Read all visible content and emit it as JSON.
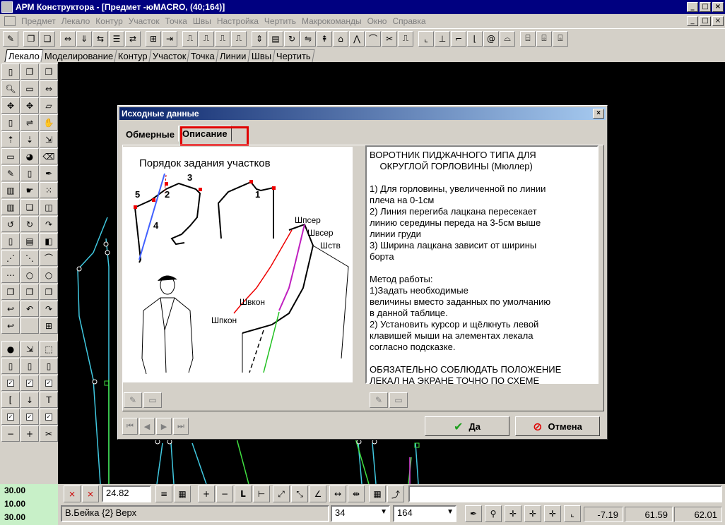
{
  "window": {
    "title": "АРМ Конструктора - [Предмет -юMACRO, (40;164)]",
    "min": "_",
    "max": "□",
    "close": "×"
  },
  "menu": [
    "Предмет",
    "Лекало",
    "Контур",
    "Участок",
    "Точка",
    "Швы",
    "Настройка",
    "Чертить",
    "Макрокоманды",
    "Окно",
    "Справка"
  ],
  "tabs": [
    "Лекало",
    "Моделирование",
    "Контур",
    "Участок",
    "Точка",
    "Линии",
    "Швы",
    "Чертить"
  ],
  "dialog": {
    "title": "Исходные данные",
    "close": "×",
    "tab1": "Обмерные",
    "tab2": "Описание",
    "image": {
      "heading": "Порядок задания участков",
      "n1": "1",
      "n2": "2",
      "n3": "3",
      "n4": "4",
      "n5": "5",
      "l1": "Шпсер",
      "l2": "Швсер",
      "l3": "Шств",
      "l4": "Швкон",
      "l5": "Шпкон"
    },
    "description": "ВОРОТНИК ПИДЖАЧНОГО ТИПА ДЛЯ\n    ОКРУГЛОЙ ГОРЛОВИНЫ (Мюллер)\n\n1) Для горловины, увеличенной по линии\nплеча на 0-1см\n2) Линия перегиба лацкана пересекает\nлинию середины переда на 3-5см выше\nлинии груди\n3) Ширина лацкана зависит от ширины\nборта\n\nМетод работы:\n1)Задать необходимые\nвеличины вместо заданных по умолчанию\nв данной таблице.\n2) Установить курсор и щёлкнуть левой\nклавишей мыши на элементах лекала\nсогласно подсказке.\n\nОБЯЗАТЕЛЬНО СОБЛЮДАТЬ ПОЛОЖЕНИЕ\nЛЕКАЛ НА ЭКРАНЕ ТОЧНО ПО СХЕМЕ",
    "ok": "Да",
    "cancel": "Отмена"
  },
  "bottom": {
    "num1": "30.00",
    "num2": "10.00",
    "num3": "30.00",
    "value": "24.82",
    "status": "В.Бейка {2} Верх",
    "combo1": "34",
    "combo2": "164",
    "coord1": "-7.19",
    "coord2": "61.59",
    "coord3": "62.01"
  },
  "colors": {
    "title_bg": "#000080",
    "canvas_bg": "#000000",
    "highlight": "#e00000",
    "line_cyan": "#40c8e0",
    "line_green": "#40e040"
  }
}
